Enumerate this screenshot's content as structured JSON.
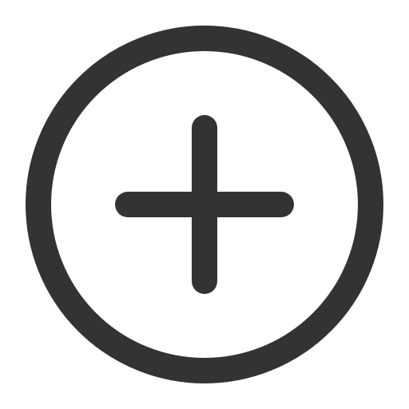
{
  "icon": {
    "name": "add-circle-icon",
    "stroke_color": "#333333",
    "background": "#ffffff"
  }
}
